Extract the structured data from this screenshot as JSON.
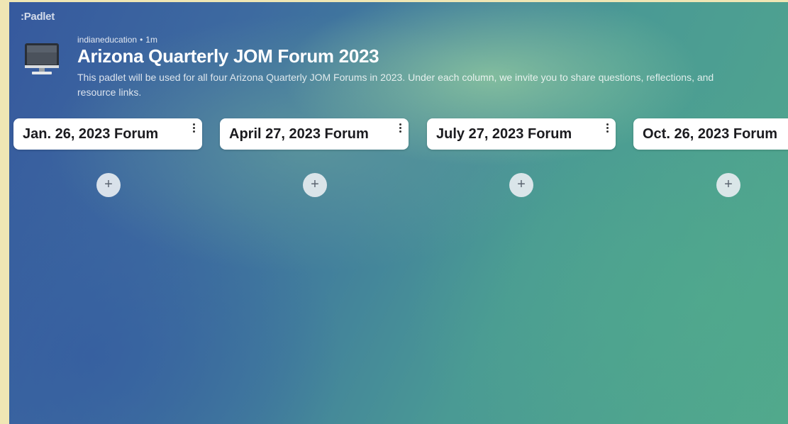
{
  "app": {
    "logo": ":Padlet"
  },
  "board": {
    "author": "indianeducation",
    "separator": "•",
    "time_ago": "1m",
    "title": "Arizona Quarterly JOM Forum 2023",
    "description": "This padlet will be used for all four Arizona Quarterly JOM Forums in 2023. Under each column, we invite you to share questions, reflections, and resource links.",
    "icon": "desktop-computer-icon"
  },
  "columns": [
    {
      "title": "Jan. 26, 2023 Forum",
      "add_label": "+"
    },
    {
      "title": "April 27, 2023 Forum",
      "add_label": "+"
    },
    {
      "title": "July 27, 2023 Forum",
      "add_label": "+"
    },
    {
      "title": "Oct. 26, 2023 Forum",
      "add_label": "+"
    }
  ],
  "colors": {
    "frame": "#efe6b4",
    "header_bg": "#ffffff",
    "title_text": "#ffffff"
  }
}
